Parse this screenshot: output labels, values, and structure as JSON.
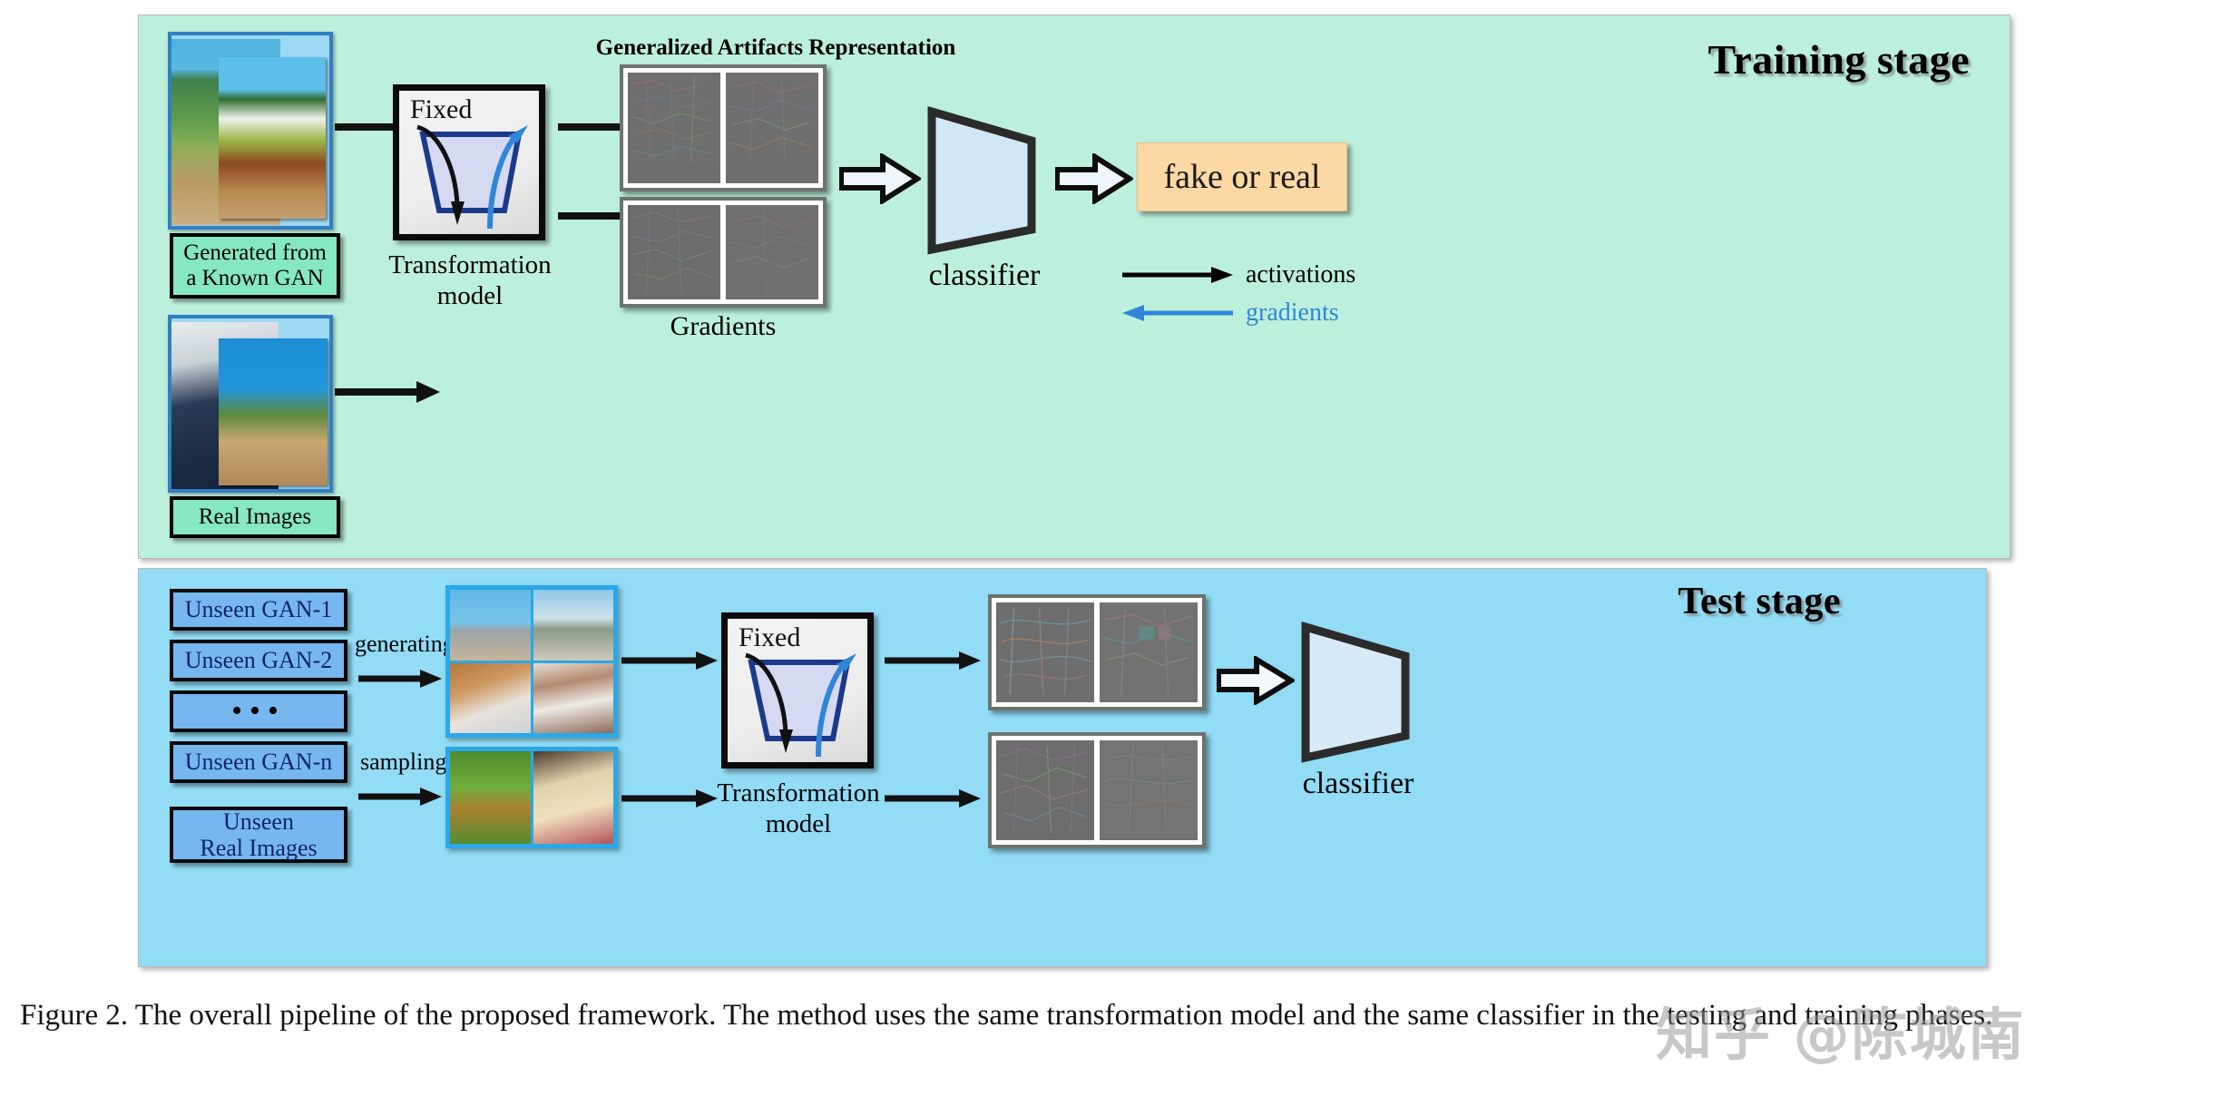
{
  "figure": {
    "caption": "Figure 2. The overall pipeline of the proposed framework. The method uses the same transformation model and the same classifier in the testing and training phases.",
    "watermark": "知乎 @陈城南"
  },
  "training_stage": {
    "title": "Training stage",
    "background_color": "#bdf0dc",
    "inputs": [
      {
        "caption": "Generated from\na Known GAN",
        "caption_line1": "Generated from",
        "caption_line2": "a Known GAN"
      },
      {
        "caption": "Real Images",
        "caption_line1": "Real Images",
        "caption_line2": ""
      }
    ],
    "transformation": {
      "fixed_label": "Fixed",
      "label_line1": "Transformation",
      "label_line2": "model"
    },
    "representation_title": "Generalized Artifacts Representation",
    "gradients_label": "Gradients",
    "classifier_label": "classifier",
    "output_label": "fake or real",
    "output_color": "#fcd9a4",
    "legend": [
      {
        "label": "activations",
        "color": "#000000",
        "direction": "right"
      },
      {
        "label": "gradients",
        "color": "#2f86d8",
        "direction": "left"
      }
    ]
  },
  "test_stage": {
    "title": "Test stage",
    "background_color": "#92dcf5",
    "sources": [
      {
        "label": "Unseen GAN-1"
      },
      {
        "label": "Unseen GAN-2"
      },
      {
        "label": "•••"
      },
      {
        "label": "Unseen GAN-n"
      }
    ],
    "real_source": {
      "label_line1": "Unseen",
      "label_line2": "Real Images"
    },
    "operations": [
      {
        "label": "generating"
      },
      {
        "label": "sampling"
      }
    ],
    "transformation": {
      "fixed_label": "Fixed",
      "label_line1": "Transformation",
      "label_line2": "model"
    },
    "classifier_label": "classifier"
  },
  "colors": {
    "training_bg": "#bdf0dc",
    "test_bg": "#92dcf5",
    "gan_box": "#76b7ef",
    "caption_box": "#86e8c0",
    "output_box": "#fcd9a4",
    "classifier_fill": "#cfe7f7",
    "gradient_blue": "#2f86d8",
    "trapezoid_stroke": "#1b3a8c"
  }
}
